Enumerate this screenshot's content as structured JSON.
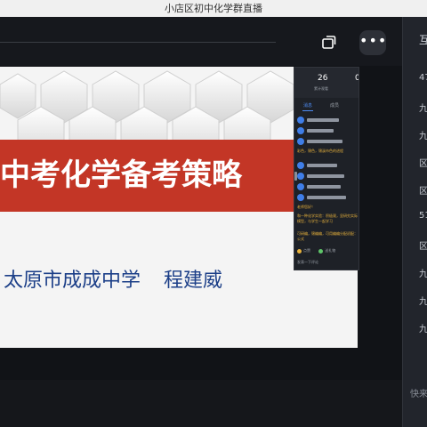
{
  "window": {
    "title": "小店区初中化学群直播"
  },
  "slide": {
    "title": "中考化学备考策略",
    "author_school": "太原市成成中学",
    "author_name": "程建威"
  },
  "chat": {
    "stats": [
      {
        "value": "26",
        "label": "累计观看"
      },
      {
        "value": "0",
        "label": ""
      }
    ],
    "tabs": [
      {
        "label": "消息"
      },
      {
        "label": "成员"
      }
    ],
    "highlight_messages": [
      {
        "text": "彩色，锦色，锦溪市色的进程"
      },
      {
        "text": "老师您好！"
      },
      {
        "text": "和一种化学实验：积极观，显研究实际模型，与学生一起学习"
      },
      {
        "text": "可研编，锦编编，可用编编分配初配：公式"
      }
    ],
    "footer": {
      "like_label": "点赞",
      "gift_label": "送礼物",
      "input_placeholder": "发表一下评论"
    },
    "colors": {
      "avatar": "#3f7ee8",
      "highlight": "#e8b23c",
      "accent": "#4e8df5"
    }
  },
  "sidebar": {
    "title": "互",
    "items": [
      "47",
      "九",
      "九",
      "区",
      "区",
      "51",
      "区",
      "九",
      "九",
      "九"
    ],
    "input_placeholder": "快来"
  },
  "icons": {
    "share": "share-screen-icon",
    "more": "more-dots-icon"
  },
  "colors": {
    "banner": "#c33626",
    "author_text": "#1c3f88",
    "background": "#111317"
  }
}
